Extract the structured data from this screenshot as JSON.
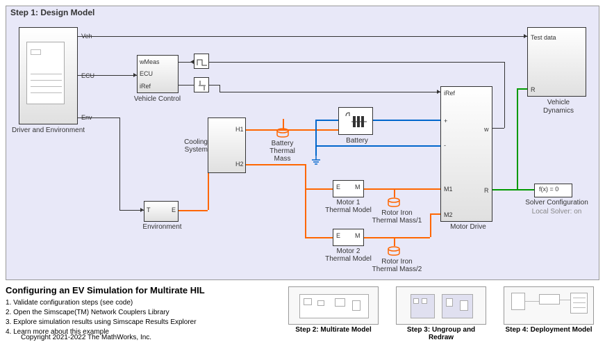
{
  "panel": {
    "title": "Step 1: Design Model"
  },
  "blocks": {
    "driver_env": {
      "label": "Driver and Environment",
      "ports": {
        "veh": "Veh",
        "ecu": "ECU",
        "env": "Env"
      }
    },
    "vehicle_control": {
      "label": "Vehicle Control",
      "ports": {
        "wmeas": "wMeas",
        "ecu": "ECU",
        "iref": "iRef"
      }
    },
    "cooling": {
      "label": "Cooling\nSystem",
      "ports": {
        "h1": "H1",
        "h2": "H2"
      }
    },
    "environment": {
      "label": "Environment",
      "ports": {
        "t": "T",
        "e": "E"
      }
    },
    "battery": {
      "label": "Battery"
    },
    "battery_thermal": {
      "label": "Battery\nThermal\nMass"
    },
    "motor1_thermal": {
      "label": "Motor 1\nThermal Model",
      "ports": {
        "e": "E",
        "m": "M"
      }
    },
    "motor2_thermal": {
      "label": "Motor 2\nThermal Model",
      "ports": {
        "e": "E",
        "m": "M"
      }
    },
    "rotor1": {
      "label": "Rotor Iron\nThermal Mass/1"
    },
    "rotor2": {
      "label": "Rotor Iron\nThermal Mass/2"
    },
    "motor_drive": {
      "label": "Motor Drive",
      "ports": {
        "iref": "iRef",
        "plus": "+",
        "minus": "-",
        "m1": "M1",
        "m2": "M2",
        "w": "w",
        "r": "R"
      }
    },
    "vehicle_dynamics": {
      "label": "Vehicle\nDynamics",
      "ports": {
        "test": "Test data",
        "r": "R"
      }
    },
    "solver": {
      "label": "Solver Configuration",
      "sublabel": "Local Solver: on",
      "expr": "f(x) = 0"
    }
  },
  "bottom": {
    "title": "Configuring an EV Simulation for Multirate HIL",
    "steps": [
      "1. Validate configuration steps (see code)",
      "2. Open the Simscape(TM) Network Couplers Library",
      "3. Explore simulation results using Simscape Results Explorer",
      "4. Learn more about this example"
    ],
    "previews": {
      "step2": "Step 2: Multirate Model",
      "step3": "Step 3: Ungroup and Redraw",
      "step4": "Step 4: Deployment Model"
    }
  },
  "copyright": "Copyright 2021-2022 The MathWorks, Inc."
}
